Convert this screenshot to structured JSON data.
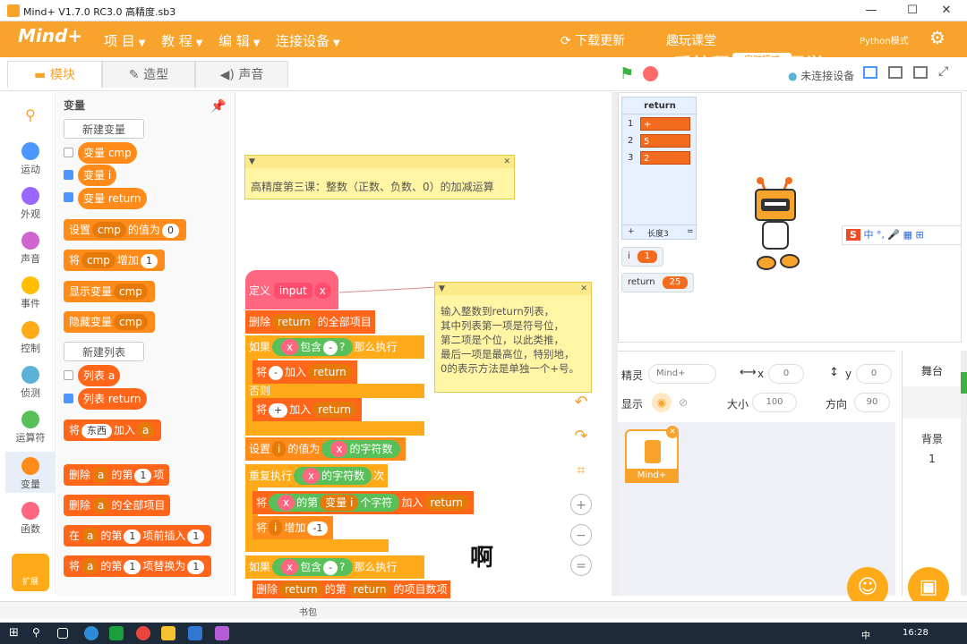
{
  "window": {
    "title": "Mind+ V1.7.0 RC3.0   高精度.sb3",
    "minimize": "—",
    "maximize": "☐",
    "close": "✕"
  },
  "menubar": {
    "logo": "Mind+",
    "items": [
      "项 目",
      "教 程",
      "编 辑",
      "连接设备"
    ],
    "download": "下载更新",
    "learn": "趣玩课堂",
    "mode_btn": "实时模式",
    "python": "Python模式",
    "watermark": "爱编程的小陈同学"
  },
  "tabs": [
    "模块",
    "造型",
    "声音"
  ],
  "stage_controls": {
    "device": "未连接设备"
  },
  "categories": [
    {
      "label": "运动",
      "color": "#4c97ff"
    },
    {
      "label": "外观",
      "color": "#9966ff"
    },
    {
      "label": "声音",
      "color": "#cf63cf"
    },
    {
      "label": "事件",
      "color": "#ffbf00"
    },
    {
      "label": "控制",
      "color": "#ffab19"
    },
    {
      "label": "侦测",
      "color": "#5cb1d6"
    },
    {
      "label": "运算符",
      "color": "#59c059"
    },
    {
      "label": "变量",
      "color": "#ff8c1a"
    },
    {
      "label": "函数",
      "color": "#ff6680"
    }
  ],
  "extension_label": "扩展",
  "palette": {
    "heading": "变量",
    "new_var": "新建变量",
    "vars": [
      "变量 cmp",
      "变量 i",
      "变量 return"
    ],
    "set": {
      "a": "设置",
      "var": "cmp",
      "b": "的值为",
      "val": "0"
    },
    "change": {
      "a": "将",
      "var": "cmp",
      "b": "增加",
      "val": "1"
    },
    "show": {
      "a": "显示变量",
      "var": "cmp"
    },
    "hide": {
      "a": "隐藏变量",
      "var": "cmp"
    },
    "new_list": "新建列表",
    "lists": [
      "列表 a",
      "列表 return"
    ],
    "add": {
      "a": "将",
      "val": "东西",
      "b": "加入",
      "list": "a"
    },
    "delete": {
      "a": "删除",
      "list": "a",
      "b": "的第",
      "val": "1",
      "c": "项"
    },
    "delete_all": {
      "a": "删除",
      "list": "a",
      "b": "的全部项目"
    },
    "insert": {
      "a": "在",
      "list": "a",
      "b": "的第",
      "val": "1",
      "c": "项前插入",
      "val2": "1"
    },
    "replace": {
      "a": "将",
      "list": "a",
      "b": "的第",
      "val": "1",
      "c": "项替换为",
      "val2": "1"
    }
  },
  "script": {
    "note1": "高精度第三课：整数（正数、负数、0）的加减运算",
    "note2_lines": [
      "输入整数到return列表，",
      "其中列表第一项是符号位，",
      "第二项是个位，以此类推，",
      "最后一项是最高位，特别地，",
      "0的表示方法是单独一个+号。"
    ],
    "define": {
      "a": "定义",
      "name": "input",
      "param": "x"
    },
    "del_all": {
      "a": "删除",
      "list": "return",
      "b": "的全部项目"
    },
    "if1": {
      "a": "如果",
      "x": "x",
      "b": "包含",
      "c": "-",
      "d": "?",
      "e": "那么执行"
    },
    "add_minus": {
      "a": "将",
      "val": "-",
      "b": "加入",
      "list": "return"
    },
    "else": "否则",
    "add_plus": {
      "a": "将",
      "val": "+",
      "b": "加入",
      "list": "return"
    },
    "set_i": {
      "a": "设置",
      "var": "i",
      "b": "的值为",
      "x": "x",
      "c": "的字符数"
    },
    "repeat": {
      "a": "重复执行",
      "x": "x",
      "b": "的字符数",
      "c": "次"
    },
    "add_char": {
      "a": "将",
      "x": "x",
      "b": "的第",
      "var": "变量 i",
      "c": "个字符",
      "d": "加入",
      "list": "return"
    },
    "change_i": {
      "a": "将",
      "var": "i",
      "b": "增加",
      "val": "-1"
    },
    "if2": {
      "a": "如果",
      "x": "x",
      "b": "包含",
      "c": "-",
      "d": "?",
      "e": "那么执行"
    },
    "del_item": {
      "a": "删除",
      "list": "return",
      "b": "的第",
      "list2": "return",
      "c": "的项目数",
      "d": "项"
    },
    "overlay_char": "啊"
  },
  "stage": {
    "list_title": "return",
    "list_items": [
      "+",
      "5",
      "2"
    ],
    "list_len": "长度3",
    "list_plus": "+",
    "list_eq": "=",
    "var_i": {
      "label": "i",
      "value": "1"
    },
    "var_return": {
      "label": "return",
      "value": "25"
    }
  },
  "sprite_info": {
    "sprite_label": "精灵",
    "sprite_name": "Mind+",
    "x_label": "x",
    "x": "0",
    "y_label": "y",
    "y": "0",
    "show_label": "显示",
    "size_label": "大小",
    "size": "100",
    "dir_label": "方向",
    "dir": "90"
  },
  "sprite_thumb": "Mind+",
  "stage_panel": {
    "label": "舞台",
    "backdrop_label": "背景",
    "backdrop_count": "1"
  },
  "bottom": "书包",
  "taskbar": {
    "lang": "中",
    "time": "16:28"
  }
}
